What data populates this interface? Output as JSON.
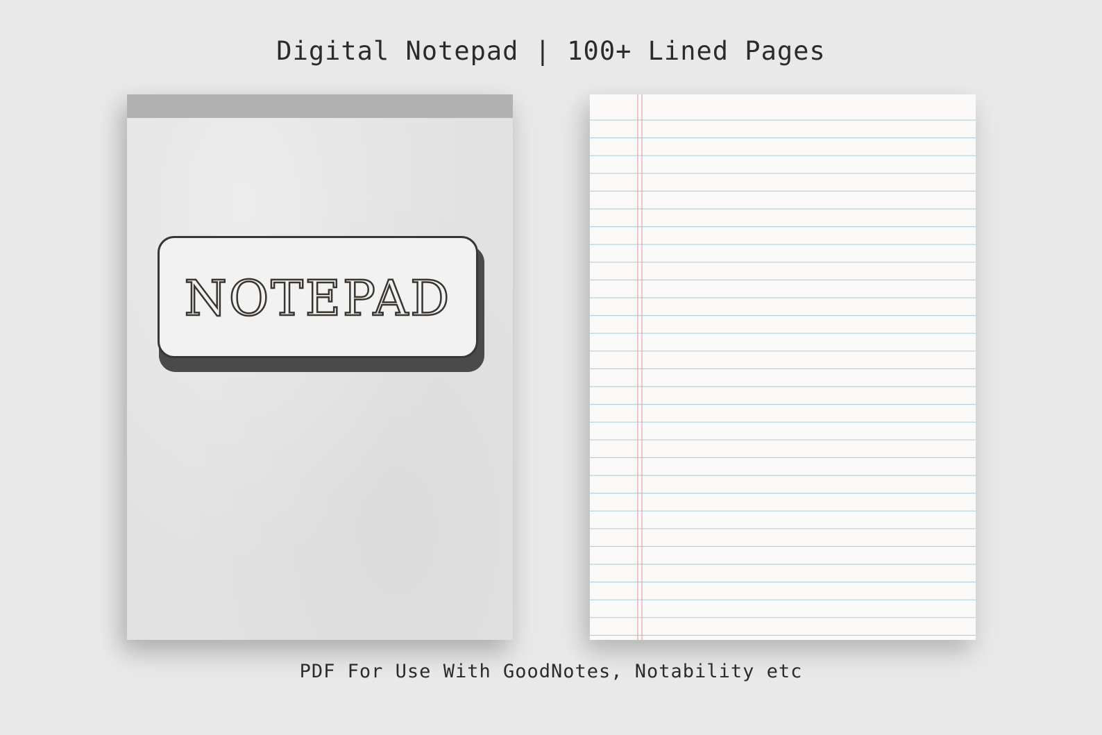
{
  "header": {
    "title": "Digital Notepad | 100+ Lined Pages"
  },
  "cover": {
    "label": "NOTEPAD"
  },
  "footer": {
    "subtitle": "PDF For Use With GoodNotes, Notability etc"
  },
  "colors": {
    "background": "#e8e9e8",
    "cover": "#e2e2e2",
    "binding": "#b1b1b1",
    "paper": "#fbfaf8",
    "rule_line": "#a9d6d9",
    "margin_line": "#e2a4ab",
    "text": "#2b2b2b"
  }
}
